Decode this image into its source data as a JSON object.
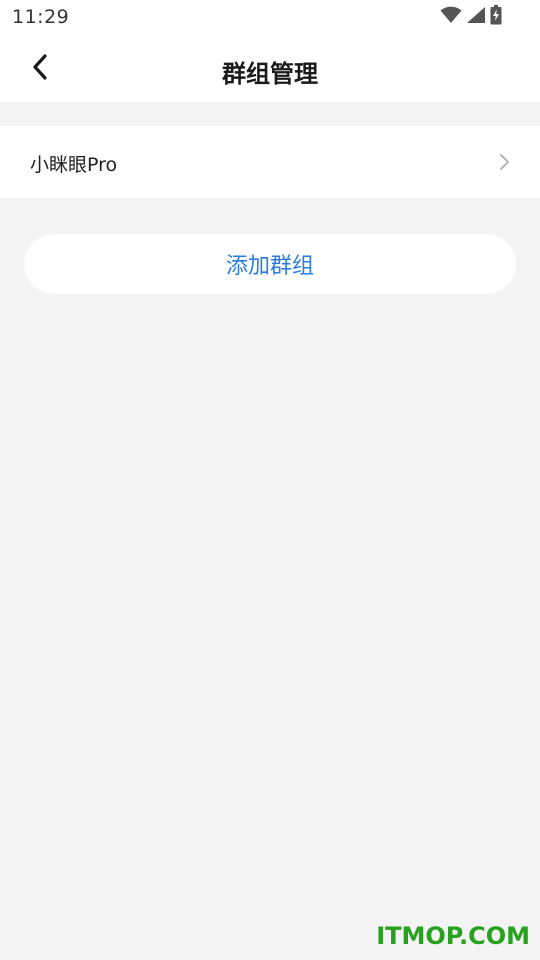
{
  "status_bar": {
    "time": "11:29",
    "icons": [
      "wifi-icon",
      "cellular-signal-icon",
      "battery-charging-icon"
    ]
  },
  "header": {
    "title": "群组管理",
    "back_icon": "chevron-left-icon"
  },
  "groups": {
    "items": [
      {
        "label": "小眯眼Pro",
        "icon": "chevron-right-icon"
      }
    ]
  },
  "actions": {
    "add_group_label": "添加群组"
  },
  "watermark": {
    "text": "ITMOP.COM"
  },
  "colors": {
    "background": "#f4f4f4",
    "surface": "#ffffff",
    "accent": "#2b7de1",
    "watermark": "#27a11e"
  }
}
